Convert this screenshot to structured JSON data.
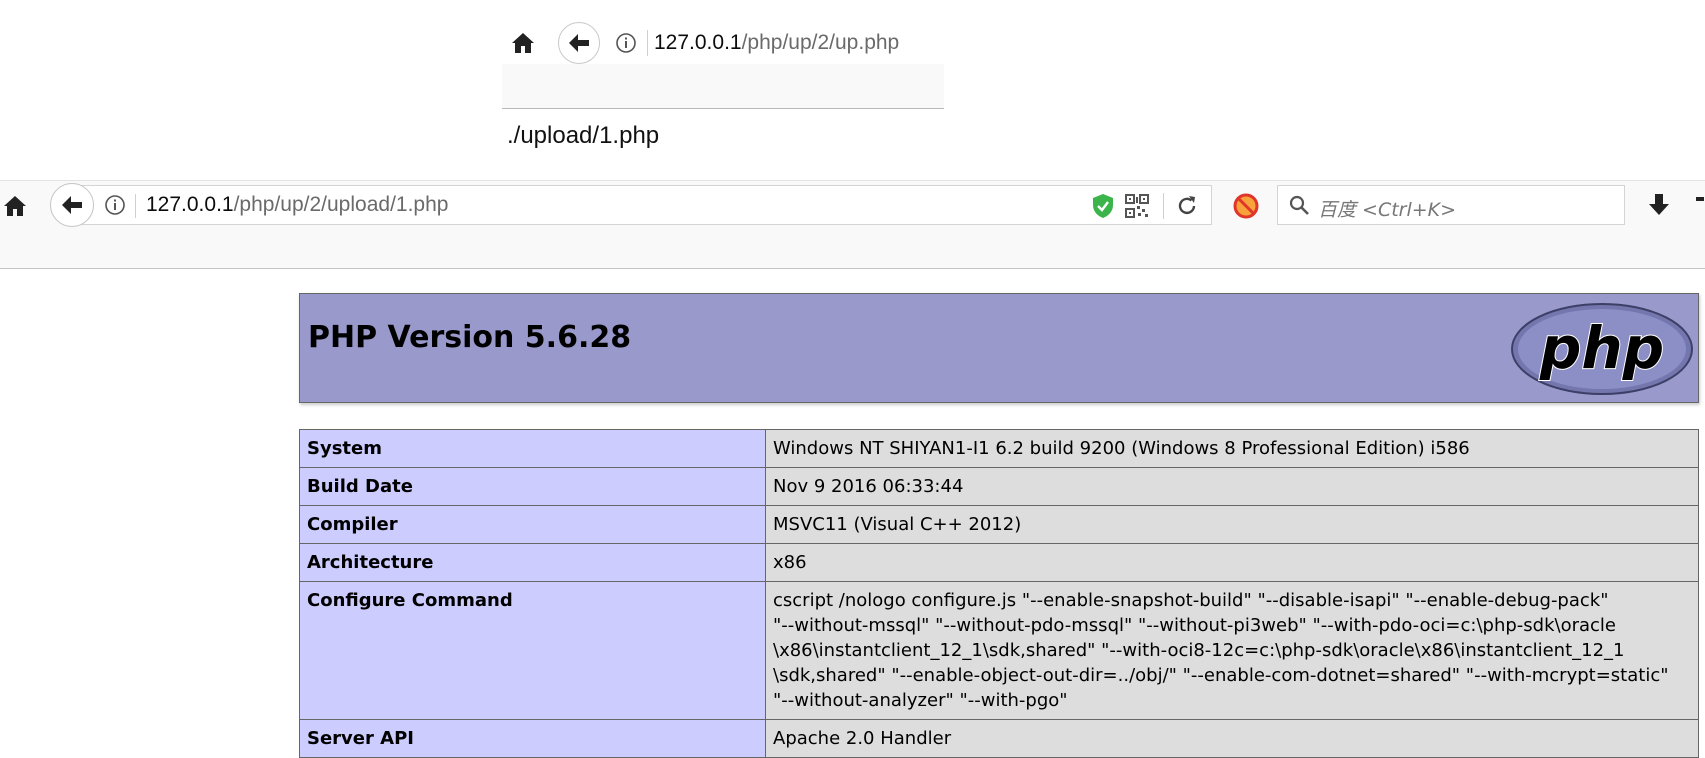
{
  "top_browser": {
    "url_host": "127.0.0.1",
    "url_path": "/php/up/2/up.php"
  },
  "page_text": "./upload/1.php",
  "main_browser": {
    "url_host": "127.0.0.1",
    "url_path": "/php/up/2/upload/1.php",
    "search_placeholder": "百度 <Ctrl+K>"
  },
  "phpinfo": {
    "title": "PHP Version 5.6.28",
    "logo_text": "php",
    "rows": [
      {
        "key": "System",
        "value": "Windows NT SHIYAN1-I1 6.2 build 9200 (Windows 8 Professional Edition) i586"
      },
      {
        "key": "Build Date",
        "value": "Nov 9 2016 06:33:44"
      },
      {
        "key": "Compiler",
        "value": "MSVC11 (Visual C++ 2012)"
      },
      {
        "key": "Architecture",
        "value": "x86"
      },
      {
        "key": "Configure Command",
        "lines": [
          "cscript /nologo configure.js \"--enable-snapshot-build\" \"--disable-isapi\" \"--enable-debug-pack\"",
          "\"--without-mssql\" \"--without-pdo-mssql\" \"--without-pi3web\" \"--with-pdo-oci=c:\\php-sdk\\oracle",
          "\\x86\\instantclient_12_1\\sdk,shared\" \"--with-oci8-12c=c:\\php-sdk\\oracle\\x86\\instantclient_12_1",
          "\\sdk,shared\" \"--enable-object-out-dir=../obj/\" \"--enable-com-dotnet=shared\" \"--with-mcrypt=static\"",
          "\"--without-analyzer\" \"--with-pgo\""
        ]
      },
      {
        "key": "Server API",
        "value": "Apache 2.0 Handler"
      }
    ]
  },
  "colors": {
    "php_header": "#9999cc",
    "key_cell": "#ccccff",
    "value_cell": "#dddddd",
    "shield_green": "#3bb44a"
  }
}
